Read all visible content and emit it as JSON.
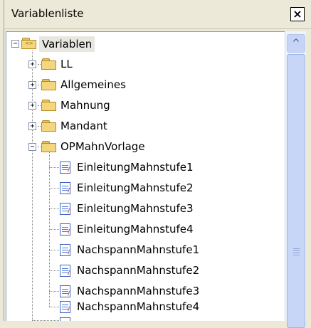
{
  "window": {
    "title": "Variablenliste",
    "close_symbol": "×"
  },
  "tree": {
    "root": {
      "label": "Variablen",
      "expander": "−",
      "icon": "folder-variable-icon"
    },
    "folders": [
      {
        "label": "LL",
        "expander": "+"
      },
      {
        "label": "Allgemeines",
        "expander": "+"
      },
      {
        "label": "Mahnung",
        "expander": "+"
      },
      {
        "label": "Mandant",
        "expander": "+"
      },
      {
        "label": "OPMahnVorlage",
        "expander": "−"
      }
    ],
    "variables": [
      "EinleitungMahnstufe1",
      "EinleitungMahnstufe2",
      "EinleitungMahnstufe3",
      "EinleitungMahnstufe4",
      "NachspannMahnstufe1",
      "NachspannMahnstufe2",
      "NachspannMahnstufe3",
      "NachspannMahnstufe4"
    ]
  },
  "scrollbar": {
    "up_arrow": "^"
  },
  "colors": {
    "folder": "#f3d67d",
    "scroll_track": "#eef3fc",
    "doc_border": "#3b64c8"
  }
}
